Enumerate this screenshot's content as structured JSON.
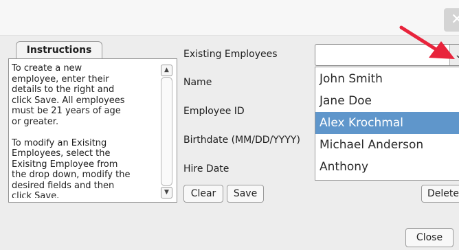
{
  "window": {
    "close_glyph": "✕"
  },
  "instructions": {
    "tab_label": "Instructions",
    "text": "To create a new\nemployee, enter their\ndetails to the right and\nclick Save. All employees\nmust be 21 years of age\nor greater.\n\nTo modify an Exisitng\nEmployees, select the\nExisitng Employee from\nthe drop down, modify the\ndesired fields and then\nclick Save.",
    "scroll_up_glyph": "▲",
    "scroll_down_glyph": "▼"
  },
  "form": {
    "existing_label": "Existing Employees",
    "name_label": "Name",
    "employee_id_label": "Employee ID",
    "birthdate_label": "Birthdate (MM/DD/YYYY)",
    "hire_date_label": "Hire Date",
    "combo_value": "",
    "combo_arrow": "⌄"
  },
  "dropdown": {
    "items": [
      {
        "label": "John Smith",
        "selected": false
      },
      {
        "label": "Jane Doe",
        "selected": false
      },
      {
        "label": "Alex Krochmal",
        "selected": true
      },
      {
        "label": "Michael Anderson",
        "selected": false
      },
      {
        "label": "Anthony",
        "selected": false
      }
    ]
  },
  "buttons": {
    "clear": "Clear",
    "save": "Save",
    "delete": "Delete",
    "close": "Close"
  },
  "annotation": {
    "arrow_color": "#e8243c"
  }
}
